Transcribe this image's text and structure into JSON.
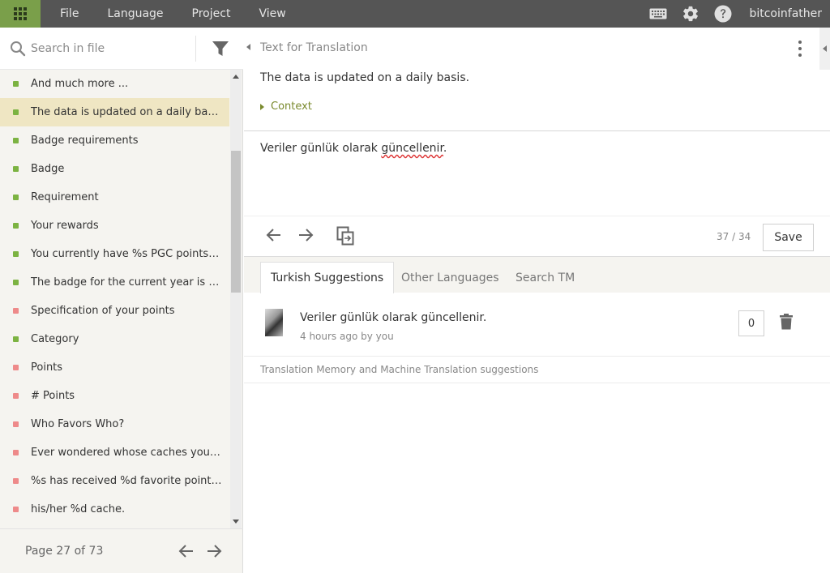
{
  "menu": {
    "items": [
      "File",
      "Language",
      "Project",
      "View"
    ]
  },
  "user": {
    "name": "bitcoinfather"
  },
  "icons": {
    "apps": "apps-grid-icon",
    "keyboard": "keyboard-icon",
    "settings": "gear-icon",
    "help": "help-icon"
  },
  "search": {
    "placeholder": "Search in file",
    "value": ""
  },
  "strings": [
    {
      "text": "And much more ...",
      "status": "translated"
    },
    {
      "text": "The data is updated on a daily basis.",
      "status": "translated",
      "selected": true
    },
    {
      "text": "Badge requirements",
      "status": "translated"
    },
    {
      "text": "Badge",
      "status": "translated"
    },
    {
      "text": "Requirement",
      "status": "translated"
    },
    {
      "text": "Your rewards",
      "status": "translated"
    },
    {
      "text": "You currently have %s PGC points, wh...",
      "status": "translated"
    },
    {
      "text": "The badge for the current year is preli...",
      "status": "translated"
    },
    {
      "text": "Specification of your points",
      "status": "untranslated"
    },
    {
      "text": "Category",
      "status": "translated"
    },
    {
      "text": "Points",
      "status": "untranslated"
    },
    {
      "text": "# Points",
      "status": "untranslated"
    },
    {
      "text": "Who Favors Who?",
      "status": "untranslated"
    },
    {
      "text": "Ever wondered whose caches you like...",
      "status": "untranslated"
    },
    {
      "text": "%s has received %d favorite point on",
      "status": "untranslated"
    },
    {
      "text": "his/her %d cache.",
      "status": "untranslated"
    }
  ],
  "pager": {
    "label": "Page 27 of 73"
  },
  "source": {
    "header": "Text for Translation",
    "text": "The data is updated on a daily basis.",
    "context_label": "Context"
  },
  "translation": {
    "before": "Veriler günlük olarak ",
    "misspelled": "güncellenir",
    "after": "."
  },
  "editor": {
    "char_count": "37 / 34",
    "save_label": "Save"
  },
  "tabs": [
    {
      "label": "Turkish Suggestions",
      "active": true
    },
    {
      "label": "Other Languages",
      "active": false
    },
    {
      "label": "Search TM",
      "active": false
    }
  ],
  "suggestion": {
    "text": "Veriler günlük olarak güncellenir.",
    "meta": "4 hours ago by you",
    "votes": "0"
  },
  "tm_note": "Translation Memory and Machine Translation suggestions",
  "colors": {
    "topbar": "#555555",
    "accent": "#7a9f4a",
    "translated": "#7cb342",
    "untranslated": "#ee8a8a",
    "selected_row": "#efe6c3"
  }
}
